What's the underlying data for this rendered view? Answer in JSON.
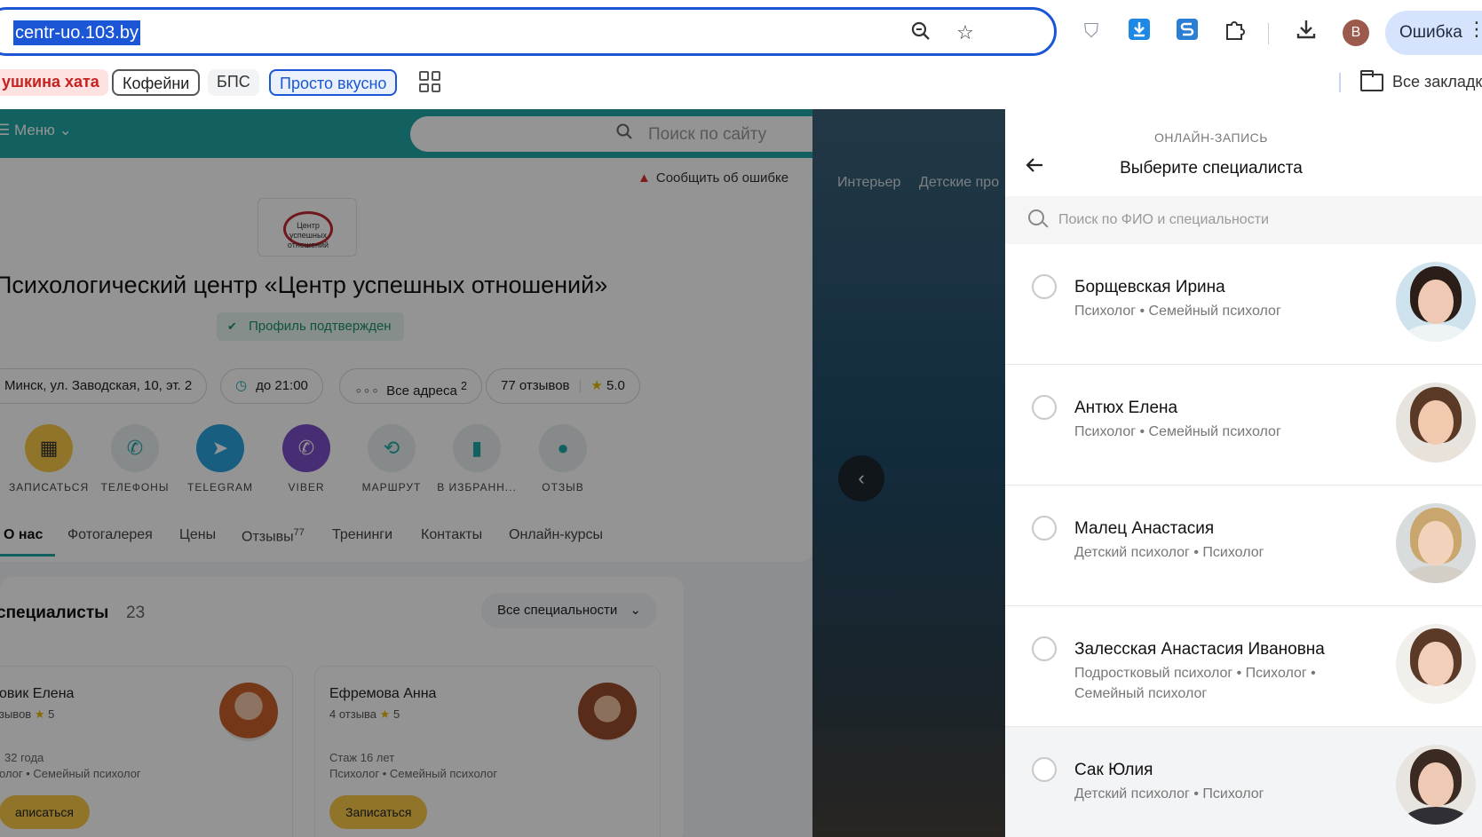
{
  "browser": {
    "url": "centr-uo.103.by",
    "error_label": "Ошибка",
    "profile_initial": "B",
    "bookmarks": [
      "ушкина хата",
      "Кофейни",
      "БПС",
      "Просто вкусно"
    ],
    "all_bookmarks_label": "Все закладки"
  },
  "site": {
    "menu_label": "Меню",
    "search_placeholder": "Поиск по сайту",
    "report_error": "Сообщить об ошибке",
    "logo_text": "Центр успешных отношений",
    "title": "Психологический центр «Центр успешных отношений»",
    "verified": "Профиль подтвержден",
    "chips": {
      "address": "Минск, ул. Заводская, 10, эт. 2",
      "hours": "до 21:00",
      "addresses": "Все адреса",
      "addresses_count": "2",
      "reviews": "77 отзывов",
      "rating": "5.0"
    },
    "actions": [
      "ЗАПИСАТЬСЯ",
      "ТЕЛЕФОНЫ",
      "TELEGRAM",
      "VIBER",
      "МАРШРУТ",
      "В ИЗБРАНН...",
      "ОТЗЫВ"
    ],
    "tabs": [
      "О нас",
      "Фотогалерея",
      "Цены",
      "Отзывы",
      "Тренинги",
      "Контакты",
      "Онлайн-курсы"
    ],
    "reviews_tab_count": "77",
    "specialists_title": "специалисты",
    "specialists_count": "23",
    "specialties_dropdown": "Все специальности",
    "cards": [
      {
        "name": "овик Елена",
        "reviews": "зывов",
        "rating": "5",
        "experience": "32 года",
        "profession": "олог • Семейный психолог",
        "button": "аписаться"
      },
      {
        "name": "Ефремова Анна",
        "reviews": "4 отзыва",
        "rating": "5",
        "experience": "Стаж 16 лет",
        "profession": "Психолог • Семейный психолог",
        "button": "Записаться"
      }
    ],
    "gallery_tabs": [
      "Интерьер",
      "Детские про"
    ]
  },
  "drawer": {
    "kicker": "ОНЛАЙН-ЗАПИСЬ",
    "title": "Выберите специалиста",
    "search_placeholder": "Поиск по ФИО и специальности",
    "specialists": [
      {
        "name": "Борщевская Ирина",
        "specialty": "Психолог • Семейный психолог"
      },
      {
        "name": "Антюх Елена",
        "specialty": "Психолог • Семейный психолог"
      },
      {
        "name": "Малец Анастасия",
        "specialty": "Детский психолог • Психолог"
      },
      {
        "name": "Залесская Анастасия Ивановна",
        "specialty": "Подростковый психолог • Психолог • Семейный психолог"
      },
      {
        "name": "Сак Юлия",
        "specialty": "Детский психолог • Психолог"
      }
    ]
  },
  "colors": {
    "accent_teal": "#20a6a6",
    "browser_blue": "#1a56d6",
    "button_yellow": "#f7c948"
  }
}
